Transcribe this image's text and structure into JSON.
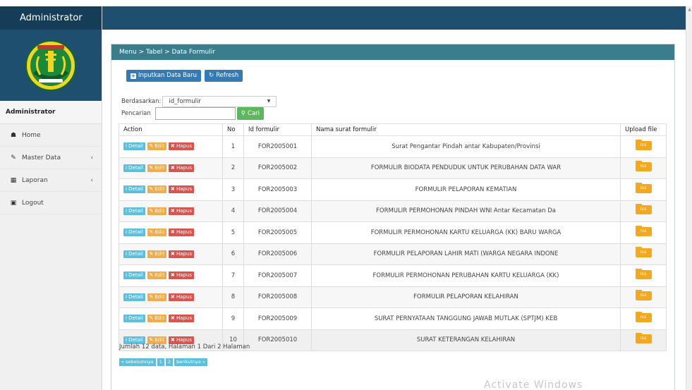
{
  "sidebar": {
    "brand": "Administrator",
    "user": "Administrator",
    "items": [
      {
        "icon": "home-icon",
        "label": "Home",
        "chevron": false
      },
      {
        "icon": "edit-icon",
        "label": "Master Data",
        "chevron": true
      },
      {
        "icon": "calendar-icon",
        "label": "Laporan",
        "chevron": true
      },
      {
        "icon": "logout-icon",
        "label": "Logout",
        "chevron": false
      }
    ]
  },
  "panel": {
    "breadcrumb": "Menu > Tabel > Data Formulir",
    "new_button": "Inputkan Data Baru",
    "refresh_button": "Refresh",
    "filter_label": "Berdasarkan:",
    "filter_value": "id_formulir",
    "search_label": "Pencarian",
    "search_value": "",
    "search_button": "Cari"
  },
  "table": {
    "headers": [
      "Action",
      "No",
      "Id formulir",
      "Nama surat formulir",
      "Upload file"
    ],
    "action_labels": {
      "detail": "Detail",
      "edit": "Edit",
      "delete": "Hapus"
    },
    "file_label": "FILE",
    "rows": [
      {
        "no": "1",
        "id": "FOR2005001",
        "name": "Surat Pengantar Pindah antar Kabupaten/Provinsi"
      },
      {
        "no": "2",
        "id": "FOR2005002",
        "name": "FORMULIR BIODATA PENDUDUK UNTUK PERUBAHAN DATA WAR"
      },
      {
        "no": "3",
        "id": "FOR2005003",
        "name": "FORMULIR PELAPORAN KEMATIAN"
      },
      {
        "no": "4",
        "id": "FOR2005004",
        "name": "FORMULIR PERMOHONAN PINDAH WNI Antar Kecamatan Da"
      },
      {
        "no": "5",
        "id": "FOR2005005",
        "name": "FORMULIR PERMOHONAN KARTU KELUARGA (KK) BARU WARGA"
      },
      {
        "no": "6",
        "id": "FOR2005006",
        "name": "FORMULIR PELAPORAN LAHIR MATI (WARGA NEGARA INDONE"
      },
      {
        "no": "7",
        "id": "FOR2005007",
        "name": "FORMULIR PERMOHONAN PERUBAHAN KARTU KELUARGA (KK)"
      },
      {
        "no": "8",
        "id": "FOR2005008",
        "name": "FORMULIR PELAPORAN KELAHIRAN"
      },
      {
        "no": "9",
        "id": "FOR2005009",
        "name": "SURAT PERNYATAAN TANGGUNG JAWAB MUTLAK (SPTJM) KEB"
      },
      {
        "no": "10",
        "id": "FOR2005010",
        "name": "SURAT KETERANGAN KELAHIRAN"
      }
    ]
  },
  "footer": {
    "summary": "Jumlah 12 data, Halaman 1 Dari 2 Halaman",
    "pager": [
      "« sebelumnya",
      "1",
      "2",
      "berikutnya »"
    ]
  },
  "watermark": "Activate Windows"
}
